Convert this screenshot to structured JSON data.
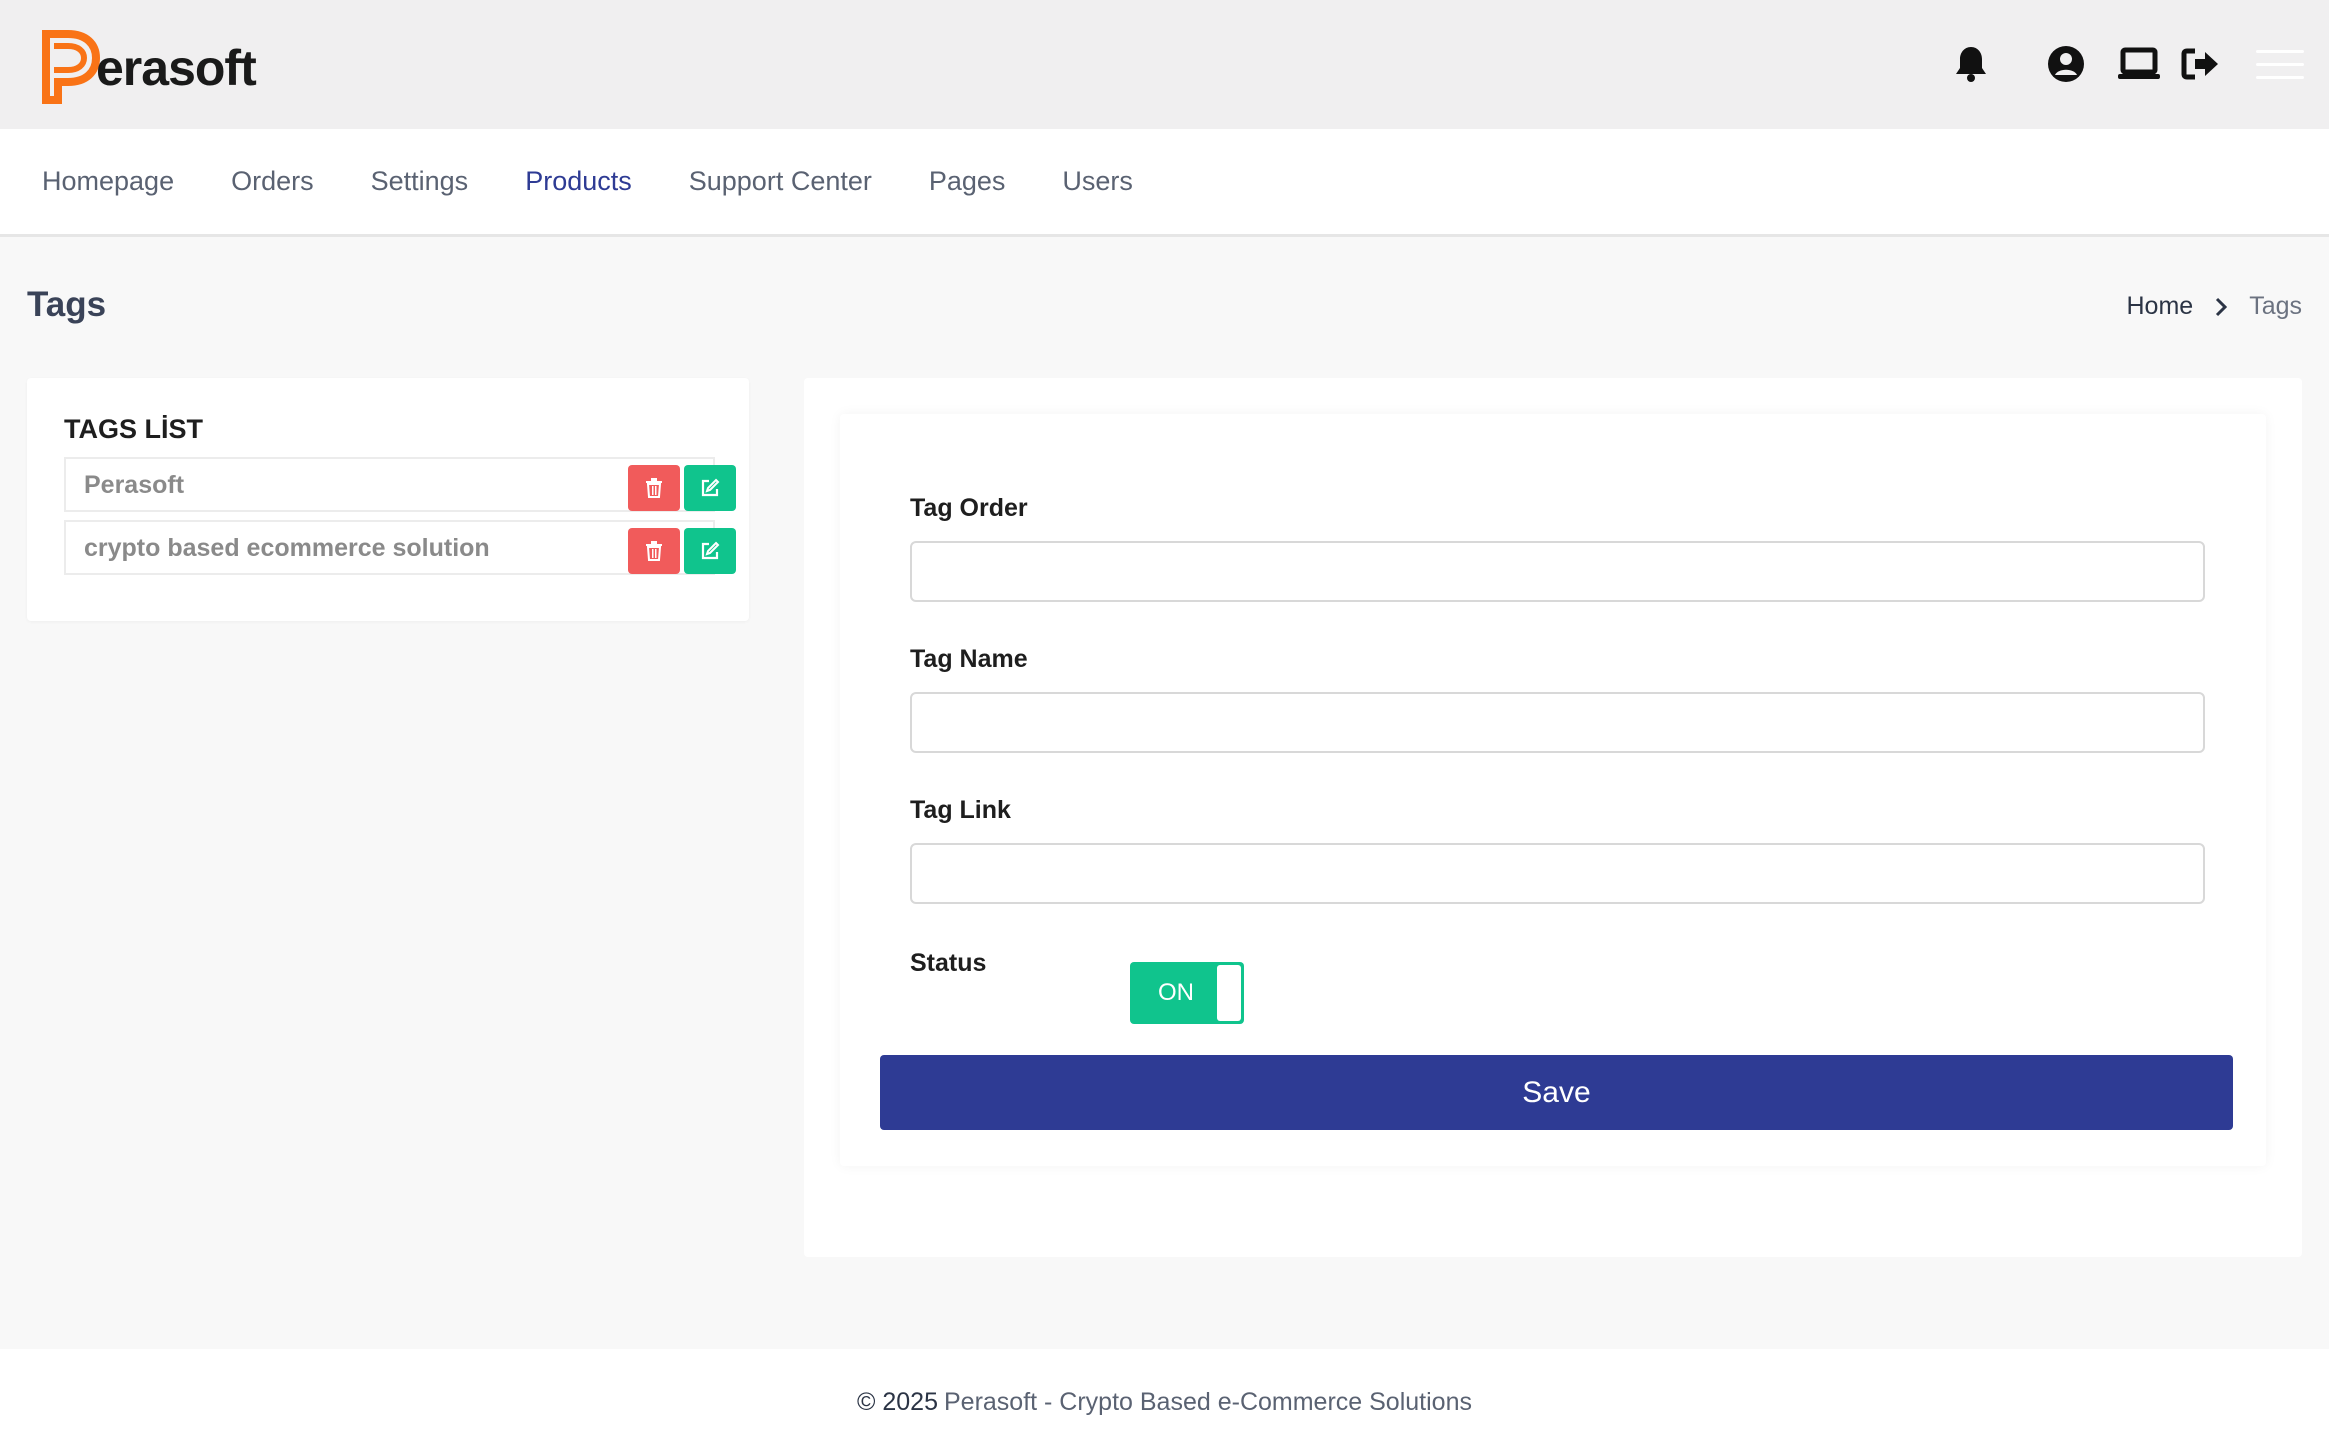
{
  "header": {
    "logo_text": "erasoft",
    "logo_letter": "P",
    "brand_color": "#f97316",
    "icons": [
      "bell-icon",
      "user-circle-icon",
      "laptop-icon",
      "sign-out-icon",
      "hamburger-menu-icon"
    ]
  },
  "nav": {
    "items": [
      {
        "label": "Homepage",
        "active": false
      },
      {
        "label": "Orders",
        "active": false
      },
      {
        "label": "Settings",
        "active": false
      },
      {
        "label": "Products",
        "active": true
      },
      {
        "label": "Support Center",
        "active": false
      },
      {
        "label": "Pages",
        "active": false
      },
      {
        "label": "Users",
        "active": false
      }
    ],
    "active_color": "#2e3b94"
  },
  "page": {
    "title": "Tags",
    "breadcrumb": {
      "home": "Home",
      "current": "Tags"
    }
  },
  "tags_list": {
    "title": "TAGS LİST",
    "items": [
      {
        "name": "Perasoft"
      },
      {
        "name": "crypto based ecommerce solution"
      }
    ],
    "delete_color": "#f15b5b",
    "edit_color": "#10c48d"
  },
  "form": {
    "fields": [
      {
        "label": "Tag Order",
        "value": ""
      },
      {
        "label": "Tag Name",
        "value": ""
      },
      {
        "label": "Tag Link",
        "value": ""
      }
    ],
    "status_label": "Status",
    "status_toggle": "ON",
    "save_label": "Save",
    "save_color": "#2e3b94"
  },
  "footer": {
    "copyright": "© 2025",
    "text": "Perasoft - Crypto Based e-Commerce Solutions"
  }
}
